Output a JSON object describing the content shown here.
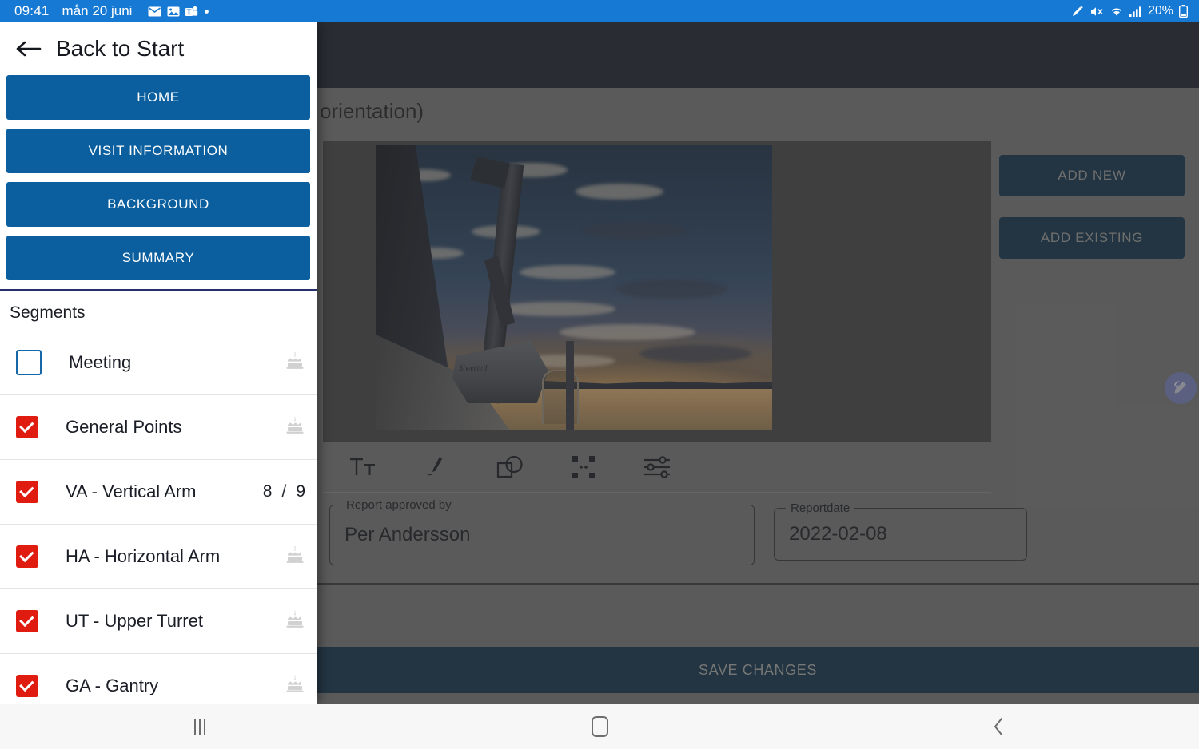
{
  "status_bar": {
    "time": "09:41",
    "date": "mån 20 juni",
    "left_icons": [
      "mail-icon",
      "photos-icon",
      "teams-icon",
      "dot-icon"
    ],
    "right_icons": [
      "pen-icon",
      "mute-icon",
      "wifi-icon",
      "signal-icon"
    ],
    "battery": "20%",
    "background": "#1679d4"
  },
  "drawer": {
    "back_label": "Back to Start",
    "back_icon": "arrow-left-icon",
    "nav_buttons": [
      {
        "label": "HOME"
      },
      {
        "label": "VISIT INFORMATION"
      },
      {
        "label": "BACKGROUND"
      },
      {
        "label": "SUMMARY"
      }
    ],
    "segments_heading": "Segments",
    "segments": [
      {
        "label": "Meeting",
        "checked": false,
        "trailing": "cake-icon",
        "count": null
      },
      {
        "label": "General Points",
        "checked": true,
        "trailing": "cake-icon",
        "count": null
      },
      {
        "label": "VA - Vertical Arm",
        "checked": true,
        "trailing": "counter",
        "count_done": "8",
        "count_total": "9"
      },
      {
        "label": "HA - Horizontal Arm",
        "checked": true,
        "trailing": "cake-icon",
        "count": null
      },
      {
        "label": "UT - Upper Turret",
        "checked": true,
        "trailing": "cake-icon",
        "count": null
      },
      {
        "label": "GA - Gantry",
        "checked": true,
        "trailing": "cake-icon",
        "count": null
      }
    ],
    "button_color": "#0b5f9e",
    "checked_color": "#e01b10",
    "divider_color": "#27306b"
  },
  "main": {
    "page_title": "orientation)",
    "photo_alt": "harbor crane at sunset",
    "toolbar": [
      {
        "icon": "text-tool-icon"
      },
      {
        "icon": "pen-tool-icon"
      },
      {
        "icon": "shapes-tool-icon"
      },
      {
        "icon": "crop-select-tool-icon"
      },
      {
        "icon": "adjustments-tool-icon"
      }
    ],
    "fields": [
      {
        "legend": "Report approved by",
        "value": "Per Andersson"
      },
      {
        "legend": "Reportdate",
        "value": "2022-02-08"
      }
    ],
    "side_actions": [
      {
        "label": "ADD NEW"
      },
      {
        "label": "ADD EXISTING"
      }
    ],
    "save_label": "SAVE CHANGES",
    "fab_icon": "stylus-edit-icon",
    "app_bar_color": "#161c26",
    "action_color": "#0b2a43"
  },
  "system_nav": {
    "recents_icon": "recents-icon",
    "home_icon": "home-icon",
    "back_icon": "back-chevron-icon"
  }
}
